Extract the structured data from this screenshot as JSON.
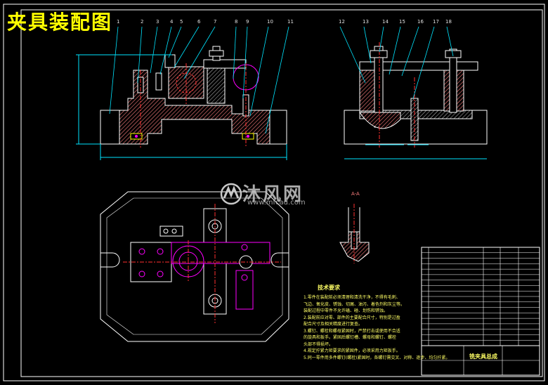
{
  "title": "夹具装配图",
  "watermark": {
    "text_cn": "沐风网",
    "url": "www.mfcad.com"
  },
  "balloons_left": [
    "1",
    "2",
    "3",
    "4",
    "5",
    "6",
    "7",
    "8",
    "9",
    "10",
    "11"
  ],
  "balloons_right": [
    "12",
    "13",
    "14",
    "15",
    "16",
    "17",
    "18"
  ],
  "section_label": "A-A",
  "notes": {
    "title": "技术要求",
    "lines": [
      "1.零件在装配前必须清理和清洗干净，不得有毛刺、",
      "  飞边、氧化皮、锈蚀、切屑、油污、着色剂和灰尘等。",
      "  装配过程中零件不允许磕、碰、划伤和锈蚀。",
      "2.装配前应对零、部件的主要配合尺寸，特别是过盈",
      "  配合尺寸及相关精度进行复查。",
      "3.螺钉、螺栓和螺母紧固时，严禁打击或使用不合适",
      "  的旋具和扳手。紧固后螺钉槽、螺母和螺钉、螺栓",
      "  头部不得损坏。",
      "4.规定拧紧力矩要求的紧固件，必须采用力矩扳手。",
      "5.同一零件用多件螺钉(螺栓)紧固时，各螺钉需交叉、对称、逐步、均匀拧紧。"
    ]
  },
  "title_block": {
    "name": "铣夹具总成"
  },
  "colors": {
    "background": "#000000",
    "outline": "#ffffff",
    "body_fill": "#ff8080",
    "hatch": "#e0e0e0",
    "leader": "#00e5ff",
    "dimension": "#00e5ff",
    "center_line": "#ff3030",
    "bolt": "#ffffff",
    "hole": "#ff00ff",
    "title": "#ffff00",
    "notes": "#ffff66",
    "watermark": "#c8c8c8"
  }
}
